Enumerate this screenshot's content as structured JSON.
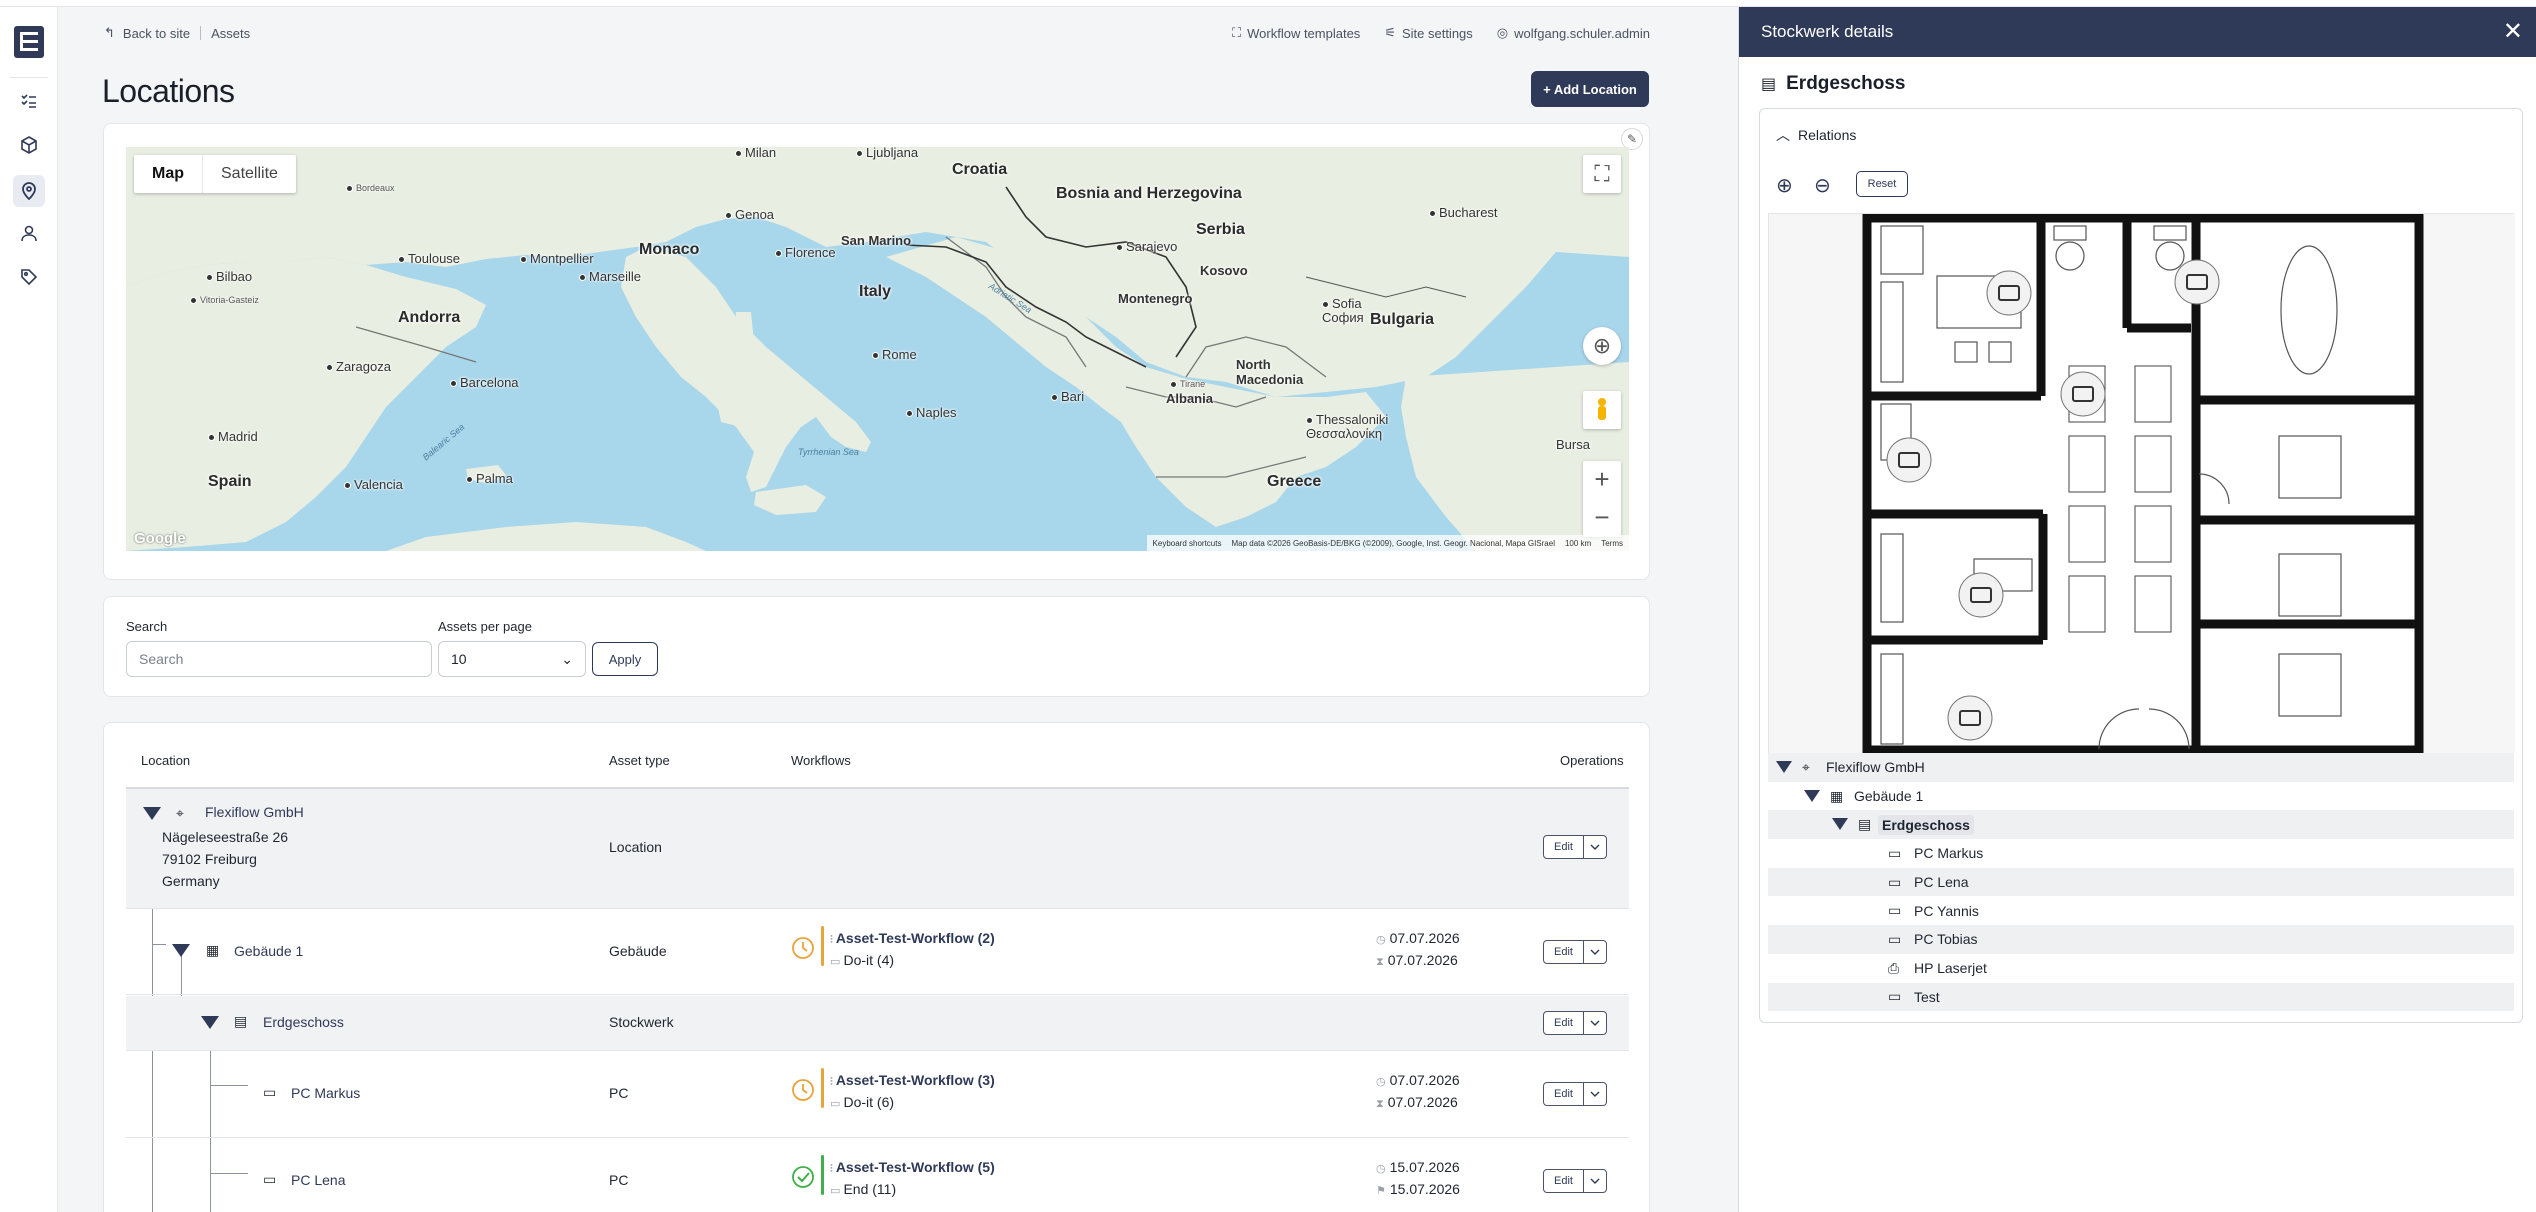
{
  "breadcrumb": {
    "back": "Back to site",
    "current": "Assets"
  },
  "toplinks": {
    "workflow_templates": "Workflow templates",
    "site_settings": "Site settings",
    "user": "wolfgang.schuler.admin"
  },
  "page": {
    "title": "Locations",
    "add_button": "+ Add Location"
  },
  "map": {
    "toggle_map": "Map",
    "toggle_satellite": "Satellite",
    "google": "Google",
    "attribution": [
      "Keyboard shortcuts",
      "Map data ©2026 GeoBasis-DE/BKG (©2009), Google, Inst. Geogr. Nacional, Mapa GISrael",
      "100 km",
      "Terms"
    ],
    "countries": [
      "Croatia",
      "Bosnia and Herzegovina",
      "Serbia",
      "Monaco",
      "San Marino",
      "Italy",
      "Andorra",
      "Montenegro",
      "Kosovo",
      "Bulgaria",
      "North Macedonia",
      "Albania",
      "Greece",
      "Spain"
    ],
    "cities": [
      "Milan",
      "Bordeaux",
      "Toulouse",
      "Montpellier",
      "Marseille",
      "Genoa",
      "Florence",
      "Sarajevo",
      "Bucharest",
      "Bilbao",
      "Vitoria-Gasteiz",
      "Zaragoza",
      "Barcelona",
      "Rome",
      "Naples",
      "Bari",
      "Tirane",
      "Sofia София",
      "Thessaloniki Θεσσαλονίκη",
      "Madrid",
      "Valencia",
      "Palma",
      "Bursa",
      "Ljubljana"
    ],
    "seas": [
      "Adriatic Sea",
      "Tyrrhenian Sea",
      "Balearic Sea"
    ],
    "label_colors": {
      "water": "#a8d6ea",
      "land": "#e9eee2"
    }
  },
  "filters": {
    "search_label": "Search",
    "search_placeholder": "Search",
    "per_page_label": "Assets per page",
    "per_page_value": "10",
    "apply": "Apply"
  },
  "table": {
    "headers": {
      "location": "Location",
      "asset_type": "Asset type",
      "workflows": "Workflows",
      "operations": "Operations"
    },
    "edit": "Edit",
    "rows": [
      {
        "name": "Flexiflow GmbH",
        "address": [
          "Nägeleseestraße 26",
          "79102 Freiburg",
          "Germany"
        ],
        "type": "Location"
      },
      {
        "name": "Gebäude 1",
        "type": "Gebäude",
        "wf_title": "Asset-Test-Workflow (2)",
        "wf_state": "Do-it (4)",
        "d1": "07.07.2026",
        "d2": "07.07.2026"
      },
      {
        "name": "Erdgeschoss",
        "type": "Stockwerk"
      },
      {
        "name": "PC Markus",
        "type": "PC",
        "wf_title": "Asset-Test-Workflow (3)",
        "wf_state": "Do-it (6)",
        "d1": "07.07.2026",
        "d2": "07.07.2026"
      },
      {
        "name": "PC Lena",
        "type": "PC",
        "wf_title": "Asset-Test-Workflow (5)",
        "wf_state": "End (11)",
        "d1": "15.07.2026",
        "d2": "15.07.2026"
      }
    ]
  },
  "panel": {
    "header": "Stockwerk details",
    "title": "Erdgeschoss",
    "relations": "Relations",
    "reset": "Reset",
    "tree": [
      {
        "label": "Flexiflow GmbH"
      },
      {
        "label": "Gebäude 1"
      },
      {
        "label": "Erdgeschoss"
      },
      {
        "label": "PC Markus"
      },
      {
        "label": "PC Lena"
      },
      {
        "label": "PC Yannis"
      },
      {
        "label": "PC Tobias"
      },
      {
        "label": "HP Laserjet"
      },
      {
        "label": "Test"
      }
    ]
  },
  "colors": {
    "primary": "#2f3a58",
    "pending": "#e9a33a",
    "done": "#3db047"
  }
}
